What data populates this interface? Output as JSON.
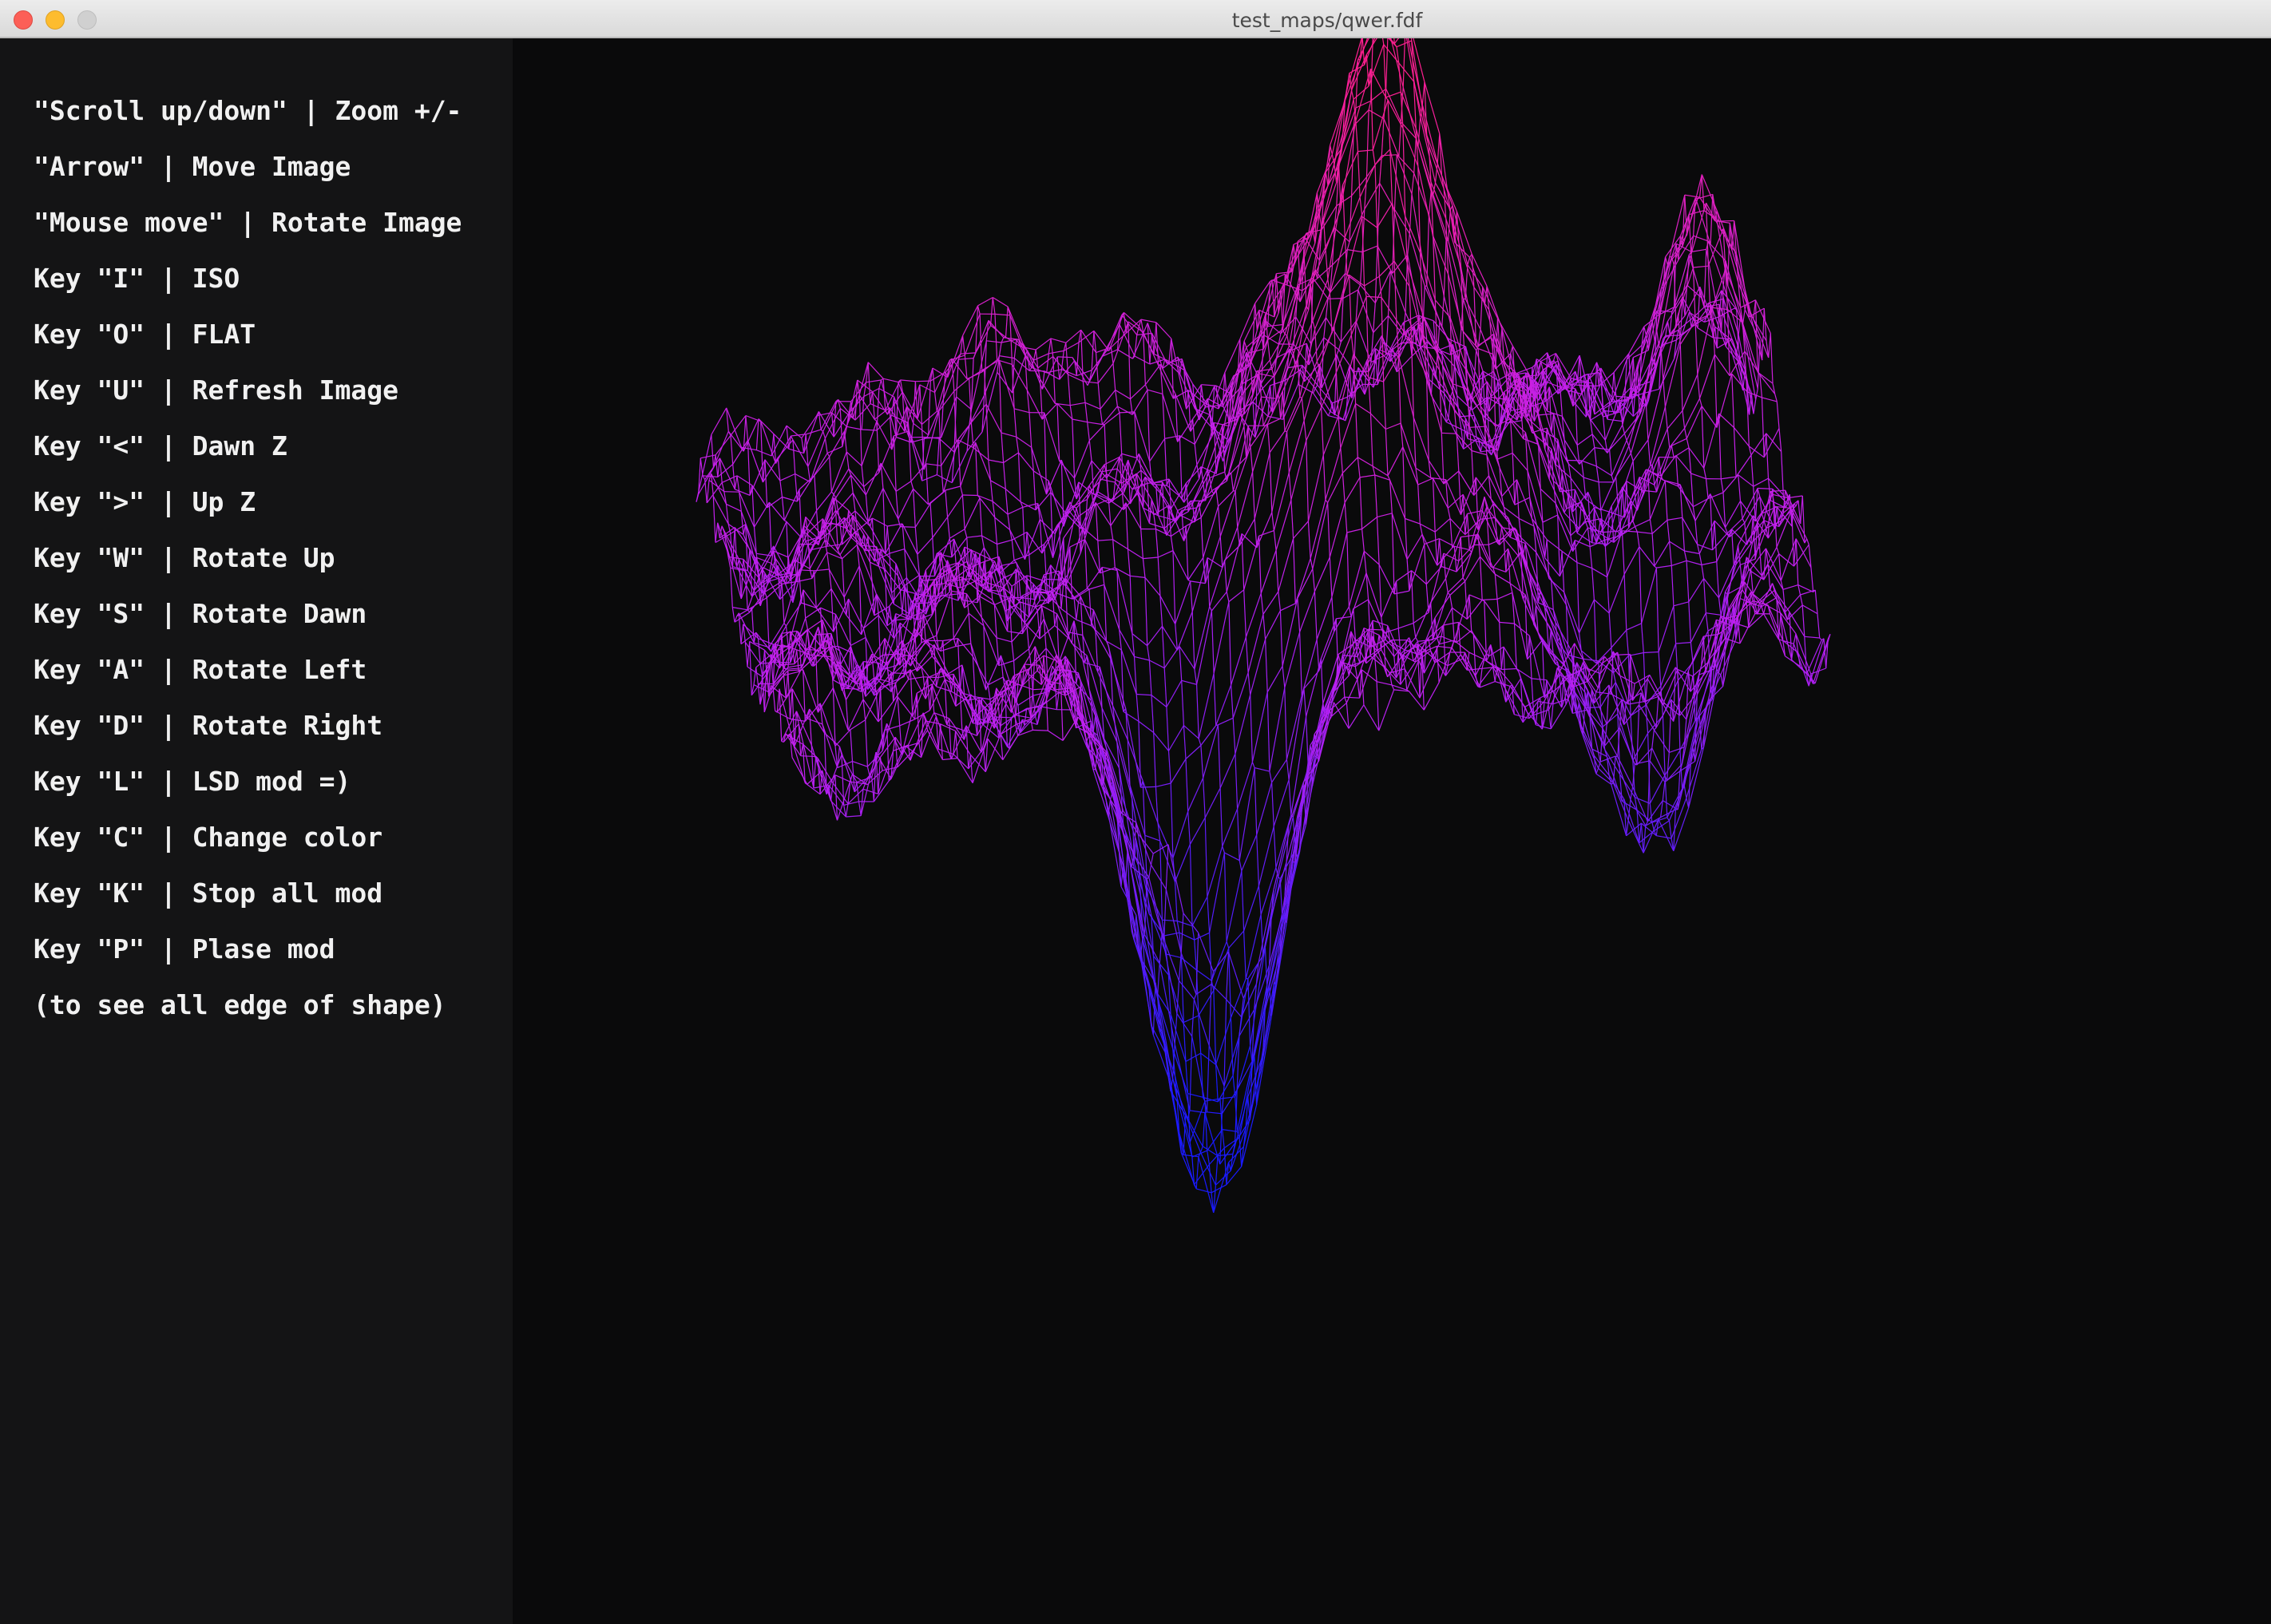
{
  "window": {
    "title": "test_maps/qwer.fdf",
    "controls": [
      "close",
      "minimize",
      "maximize"
    ]
  },
  "help": {
    "lines": [
      "\"Scroll up/down\" | Zoom +/-",
      "\"Arrow\" | Move Image",
      "\"Mouse move\" | Rotate Image",
      "Key \"I\" | ISO",
      "Key \"O\" | FLAT",
      "Key \"U\" | Refresh Image",
      "Key \"<\" | Dawn Z",
      "Key \">\" | Up Z",
      "Key \"W\" | Rotate Up",
      "Key \"S\" | Rotate Dawn",
      "Key \"A\" | Rotate Left",
      "Key \"D\" | Rotate Right",
      "Key \"L\" | LSD mod =)",
      "Key \"C\" | Change color",
      "Key \"K\" | Stop all mod",
      "Key \"P\" | Plase mod",
      "(to see all edge of shape)"
    ]
  },
  "render": {
    "colors": {
      "high": "#ff1f8f",
      "mid": "#c020f0",
      "low": "#1a1aff",
      "background": "#0a0a0b"
    }
  }
}
